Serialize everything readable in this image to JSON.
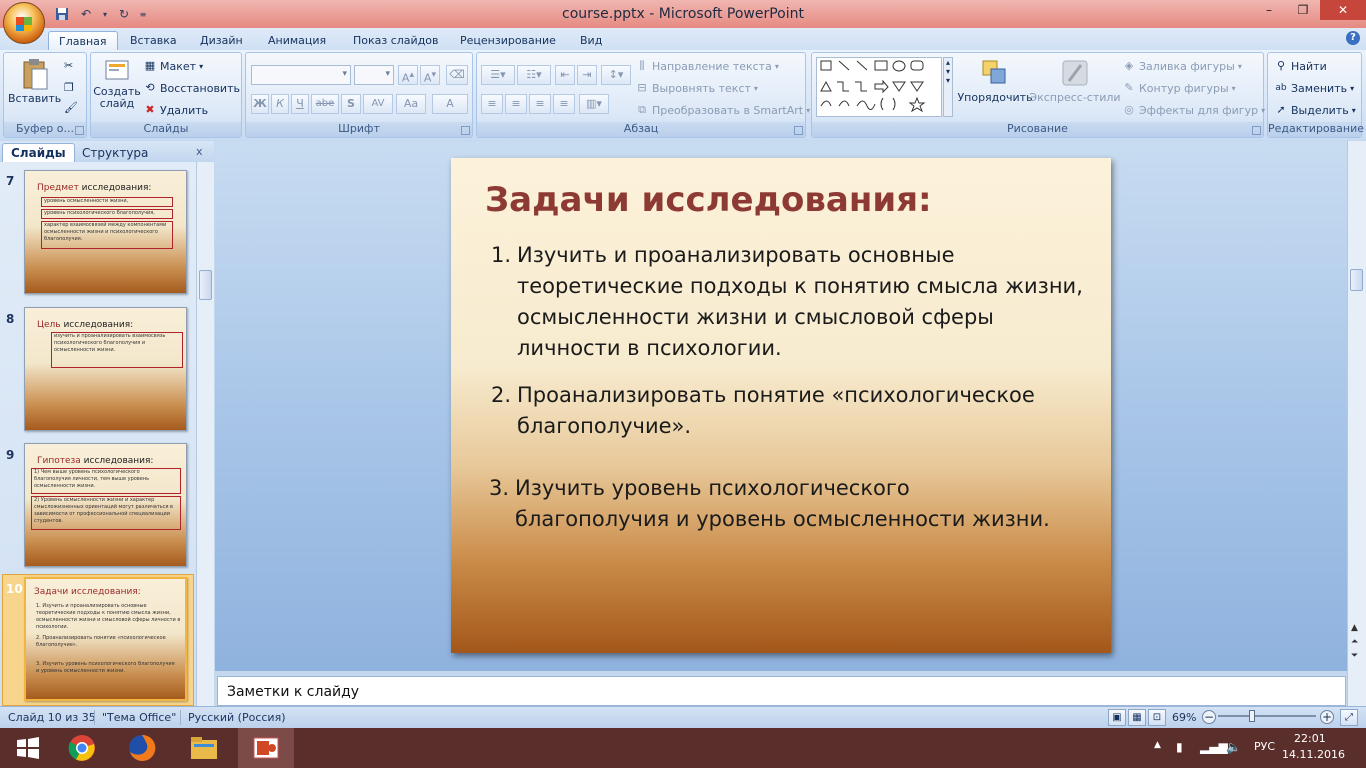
{
  "window": {
    "title": "course.pptx - Microsoft PowerPoint",
    "minimize_icon": "minimize-icon",
    "maximize_icon": "restore-icon",
    "close_icon": "close-icon"
  },
  "quick_access": {
    "save_icon": "save-icon",
    "undo_icon": "undo-icon",
    "redo_icon": "redo-icon",
    "customize_icon": "chevron-down-icon"
  },
  "tabs": [
    {
      "label": "Главная",
      "active": true
    },
    {
      "label": "Вставка"
    },
    {
      "label": "Дизайн"
    },
    {
      "label": "Анимация"
    },
    {
      "label": "Показ слайдов"
    },
    {
      "label": "Рецензирование"
    },
    {
      "label": "Вид"
    }
  ],
  "ribbon": {
    "clipboard": {
      "label": "Буфер о...",
      "paste": "Вставить"
    },
    "slides": {
      "label": "Слайды",
      "new_slide": "Создать слайд",
      "layout": "Макет",
      "reset": "Восстановить",
      "delete": "Удалить"
    },
    "font": {
      "label": "Шрифт",
      "bold": "Ж",
      "italic": "К",
      "underline": "Ч",
      "strike": "abe",
      "shadow": "S",
      "spacing": "AV",
      "case": "Aa",
      "color": "A"
    },
    "paragraph": {
      "label": "Абзац",
      "text_direction": "Направление текста",
      "align_text": "Выровнять текст",
      "smartart": "Преобразовать в SmartArt"
    },
    "drawing": {
      "label": "Рисование",
      "arrange": "Упорядочить",
      "quick_styles": "Экспресс-стили",
      "fill": "Заливка фигуры",
      "outline": "Контур фигуры",
      "effects": "Эффекты для фигур"
    },
    "editing": {
      "label": "Редактирование",
      "find": "Найти",
      "replace": "Заменить",
      "select": "Выделить"
    }
  },
  "panel": {
    "tab_slides": "Слайды",
    "tab_outline": "Структура",
    "close": "x"
  },
  "thumbnails": [
    {
      "number": "7",
      "title_accent": "Предмет",
      "title_rest": " исследования:",
      "boxes": [
        "уровень осмысленности жизни,",
        "уровень психологического благополучия,",
        "характер взаимосвязей между компонентами осмысленности жизни и психологического благополучия."
      ]
    },
    {
      "number": "8",
      "title_accent": "Цель",
      "title_rest": " исследования:",
      "boxes": [
        "изучить и проанализировать взаимосвязь психологического благополучия и осмысленности жизни."
      ]
    },
    {
      "number": "9",
      "title_accent": "Гипотеза",
      "title_rest": " исследования:",
      "boxes": [
        "1) Чем выше уровень психологического благополучия личности, тем выше уровень осмысленности жизни.",
        "2) Уровень осмысленности жизни и характер смысложизненных ориентаций могут различаться в зависимости от профессиональной специализации студентов."
      ]
    },
    {
      "number": "10",
      "title_accent": "",
      "title_rest": "Задачи исследования:",
      "lines": [
        "1. Изучить и проанализировать основные теоретические подходы к понятию смысла жизни, осмысленности жизни и смысловой сферы личности в психологии.",
        "2. Проанализировать понятие «психологическое благополучие».",
        "3. Изучить уровень психологического благополучия и уровень осмысленности жизни."
      ]
    }
  ],
  "slide": {
    "title": "Задачи исследования:",
    "items": [
      {
        "num": "1.",
        "lines": [
          "Изучить и проанализировать основные",
          "теоретические подходы к понятию смысла жизни,",
          "осмысленности жизни и смысловой сферы",
          "личности в психологии."
        ]
      },
      {
        "num": "2.",
        "lines": [
          "Проанализировать понятие «психологическое",
          "благополучие»."
        ]
      },
      {
        "num": "3.",
        "lines": [
          "Изучить уровень психологического",
          "благополучия и уровень осмысленности жизни."
        ]
      }
    ]
  },
  "notes": {
    "placeholder": "Заметки к слайду"
  },
  "status": {
    "slide_info": "Слайд 10 из 35",
    "theme": "\"Тема Office\"",
    "language": "Русский (Россия)",
    "zoom": "69%",
    "zoom_fraction": 0.69
  },
  "taskbar": {
    "apps": [
      "start-icon",
      "chrome-icon",
      "firefox-icon",
      "file-explorer-icon",
      "powerpoint-icon"
    ],
    "lang": "РУС",
    "time": "22:01",
    "date": "14.11.2016"
  },
  "colors": {
    "title_accent": "#8e3a34",
    "titlebar": "#e58a82",
    "taskbar": "#5a2e2b"
  }
}
